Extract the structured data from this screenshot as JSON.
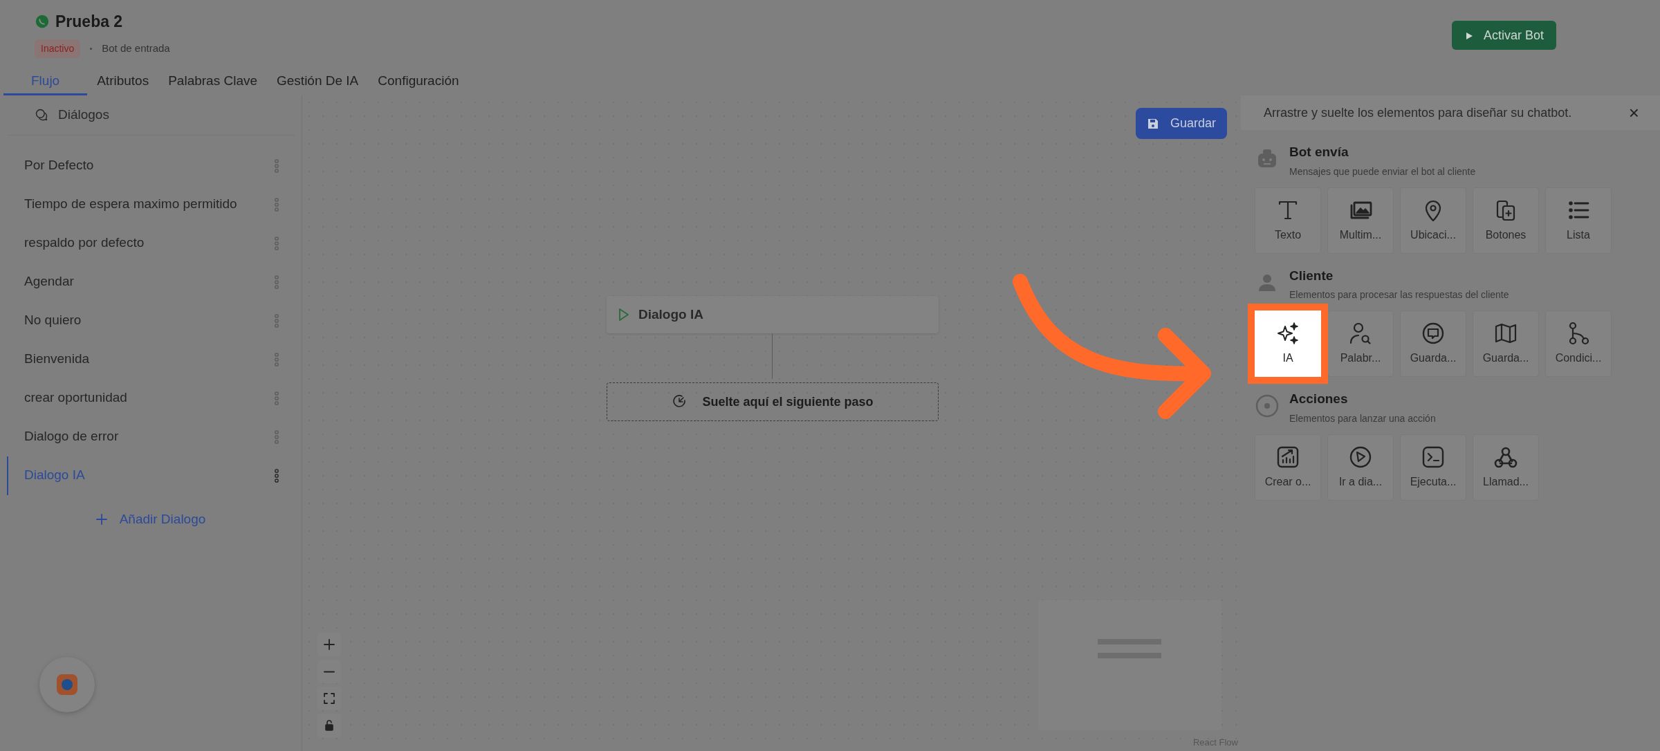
{
  "bot": {
    "title": "Prueba 2",
    "status": "Inactivo",
    "type": "Bot de entrada",
    "activate_button": "Activar Bot"
  },
  "tabs": [
    {
      "label": "Flujo",
      "selected": true
    },
    {
      "label": "Atributos",
      "selected": false
    },
    {
      "label": "Palabras Clave",
      "selected": false
    },
    {
      "label": "Gestión De IA",
      "selected": false
    },
    {
      "label": "Configuración",
      "selected": false
    }
  ],
  "sidebar": {
    "title": "Diálogos",
    "items": [
      {
        "label": "Por Defecto",
        "selected": false
      },
      {
        "label": "Tiempo de espera maximo permitido",
        "selected": false
      },
      {
        "label": "respaldo por defecto",
        "selected": false
      },
      {
        "label": "Agendar",
        "selected": false
      },
      {
        "label": "No quiero",
        "selected": false
      },
      {
        "label": "Bienvenida",
        "selected": false
      },
      {
        "label": "crear oportunidad",
        "selected": false
      },
      {
        "label": "Dialogo de error",
        "selected": false
      },
      {
        "label": "Dialogo IA",
        "selected": true
      }
    ],
    "add_button": "Añadir Dialogo"
  },
  "canvas": {
    "save_button": "Guardar",
    "node": {
      "title": "Dialogo IA"
    },
    "drop_zone": "Suelte aquí el siguiente paso",
    "attribution": "React Flow"
  },
  "palette": {
    "hint": "Arrastre y suelte los elementos para diseñar su chatbot.",
    "close": "×",
    "sections": [
      {
        "title": "Bot envía",
        "subtitle": "Mensajes que puede enviar el bot al cliente",
        "items": [
          {
            "label": "Texto",
            "highlighted": false
          },
          {
            "label": "Multim...",
            "highlighted": false
          },
          {
            "label": "Ubicaci...",
            "highlighted": false
          },
          {
            "label": "Botones",
            "highlighted": false
          },
          {
            "label": "Lista",
            "highlighted": false
          }
        ]
      },
      {
        "title": "Cliente",
        "subtitle": "Elementos para procesar las respuestas del cliente",
        "items": [
          {
            "label": "IA",
            "highlighted": true
          },
          {
            "label": "Palabr...",
            "highlighted": false
          },
          {
            "label": "Guarda...",
            "highlighted": false
          },
          {
            "label": "Guarda...",
            "highlighted": false
          },
          {
            "label": "Condici...",
            "highlighted": false
          }
        ]
      },
      {
        "title": "Acciones",
        "subtitle": "Elementos para lanzar una acción",
        "items": [
          {
            "label": "Crear o...",
            "highlighted": false
          },
          {
            "label": "Ir a dia...",
            "highlighted": false
          },
          {
            "label": "Ejecuta...",
            "highlighted": false
          },
          {
            "label": "Llamad...",
            "highlighted": false
          }
        ]
      }
    ]
  }
}
